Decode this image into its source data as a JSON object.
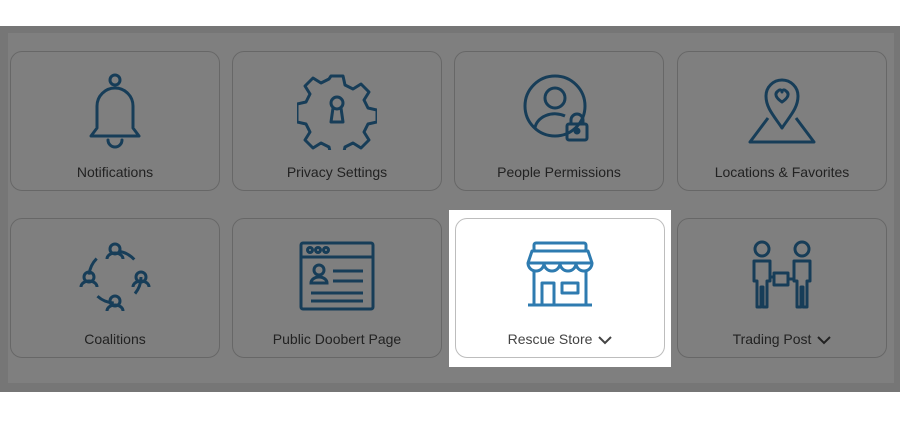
{
  "tiles": [
    {
      "label": "Notifications",
      "icon": "bell-icon",
      "chevron": false
    },
    {
      "label": "Privacy Settings",
      "icon": "gear-lock-icon",
      "chevron": false
    },
    {
      "label": "People Permissions",
      "icon": "person-lock-icon",
      "chevron": false
    },
    {
      "label": "Locations & Favorites",
      "icon": "map-heart-pin-icon",
      "chevron": false
    },
    {
      "label": "Coalitions",
      "icon": "network-people-icon",
      "chevron": false
    },
    {
      "label": "Public Doobert Page",
      "icon": "browser-profile-icon",
      "chevron": false
    },
    {
      "label": "Rescue Store",
      "icon": "storefront-icon",
      "chevron": true
    },
    {
      "label": "Trading Post",
      "icon": "people-exchange-icon",
      "chevron": true
    }
  ],
  "colors": {
    "icon": "#2e7bb0",
    "overlay": "rgba(0,0,0,0.5)"
  }
}
